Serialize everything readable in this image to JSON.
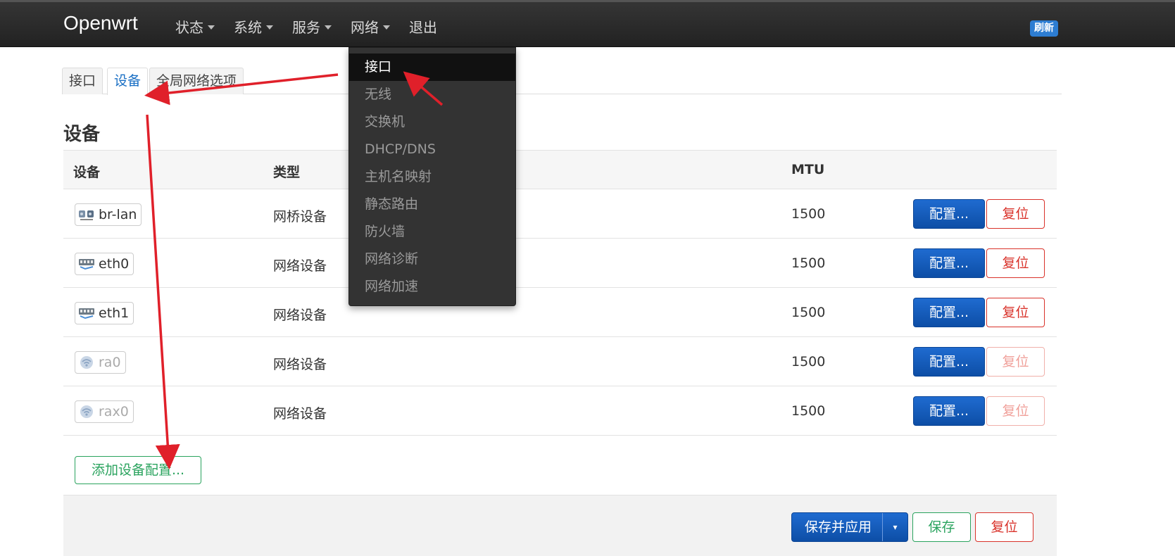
{
  "brand": "Openwrt",
  "nav": [
    {
      "label": "状态",
      "has_caret": true
    },
    {
      "label": "系统",
      "has_caret": true
    },
    {
      "label": "服务",
      "has_caret": true
    },
    {
      "label": "网络",
      "has_caret": true
    },
    {
      "label": "退出",
      "has_caret": false
    }
  ],
  "refresh_label": "刷新",
  "tabs": [
    {
      "label": "接口",
      "active": false
    },
    {
      "label": "设备",
      "active": true
    },
    {
      "label": "全局网络选项",
      "active": false
    }
  ],
  "section_title": "设备",
  "table": {
    "headers": {
      "device": "设备",
      "type": "类型",
      "mtu": "MTU"
    },
    "rows": [
      {
        "device": "br-lan",
        "type": "网桥设备",
        "mtu": "1500",
        "icon": "bridge-icon",
        "dim": false,
        "config": "配置...",
        "reset": "复位"
      },
      {
        "device": "eth0",
        "type": "网络设备",
        "mtu": "1500",
        "icon": "ethernet-icon",
        "dim": false,
        "config": "配置...",
        "reset": "复位"
      },
      {
        "device": "eth1",
        "type": "网络设备",
        "mtu": "1500",
        "icon": "ethernet-icon",
        "dim": false,
        "config": "配置...",
        "reset": "复位"
      },
      {
        "device": "ra0",
        "type": "网络设备",
        "mtu": "1500",
        "icon": "wifi-icon",
        "dim": true,
        "config": "配置...",
        "reset": "复位"
      },
      {
        "device": "rax0",
        "type": "网络设备",
        "mtu": "1500",
        "icon": "wifi-icon",
        "dim": true,
        "config": "配置...",
        "reset": "复位"
      }
    ]
  },
  "add_device_label": "添加设备配置...",
  "footer": {
    "save_apply": "保存并应用",
    "split_caret": "▾",
    "save": "保存",
    "reset": "复位"
  },
  "dropdown": [
    {
      "label": "接口",
      "active": true
    },
    {
      "label": "无线",
      "active": false
    },
    {
      "label": "交换机",
      "active": false
    },
    {
      "label": "DHCP/DNS",
      "active": false
    },
    {
      "label": "主机名映射",
      "active": false
    },
    {
      "label": "静态路由",
      "active": false
    },
    {
      "label": "防火墙",
      "active": false
    },
    {
      "label": "网络诊断",
      "active": false
    },
    {
      "label": "网络加速",
      "active": false
    }
  ],
  "colors": {
    "topbar": "#2b2b2b",
    "primary_button": "#1a5fc0",
    "danger": "#d9322a",
    "success": "#2aa35e",
    "annotation_arrow": "#e0202a",
    "active_tab_text": "#1a6fc4"
  }
}
